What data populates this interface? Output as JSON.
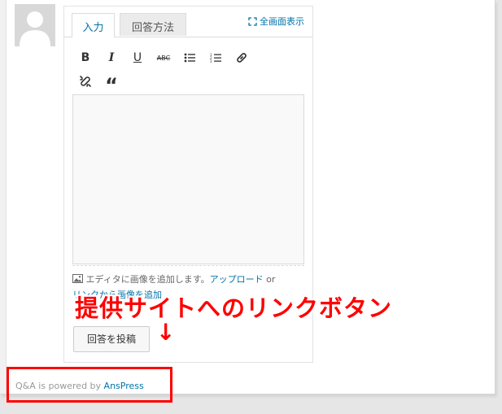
{
  "editor": {
    "tabs": [
      {
        "label": "入力",
        "active": true
      },
      {
        "label": "回答方法",
        "active": false
      }
    ],
    "fullscreen_label": "全画面表示",
    "toolbar": [
      "bold-icon",
      "italic-icon",
      "underline-icon",
      "strikethrough-icon",
      "bullet-list-icon",
      "numbered-list-icon",
      "link-icon",
      "unlink-icon",
      "blockquote-icon"
    ],
    "toolbar_glyphs": {
      "bold": "B",
      "italic": "I",
      "underline": "U",
      "strike": "ABC",
      "quote": "“"
    },
    "hint_text": "エディタに画像を追加します。",
    "upload_link": "アップロード",
    "or_text": "or",
    "link_line": "リンクから画像を追加",
    "submit_label": "回答を投稿"
  },
  "footer": {
    "powered_by": "Q&A is powered by",
    "powered_link": "AnsPress"
  },
  "annotation": {
    "text": "提供サイトへのリンクボタン",
    "arrow": "↓"
  },
  "colors": {
    "link": "#0073aa",
    "annotation": "#ff0000"
  }
}
